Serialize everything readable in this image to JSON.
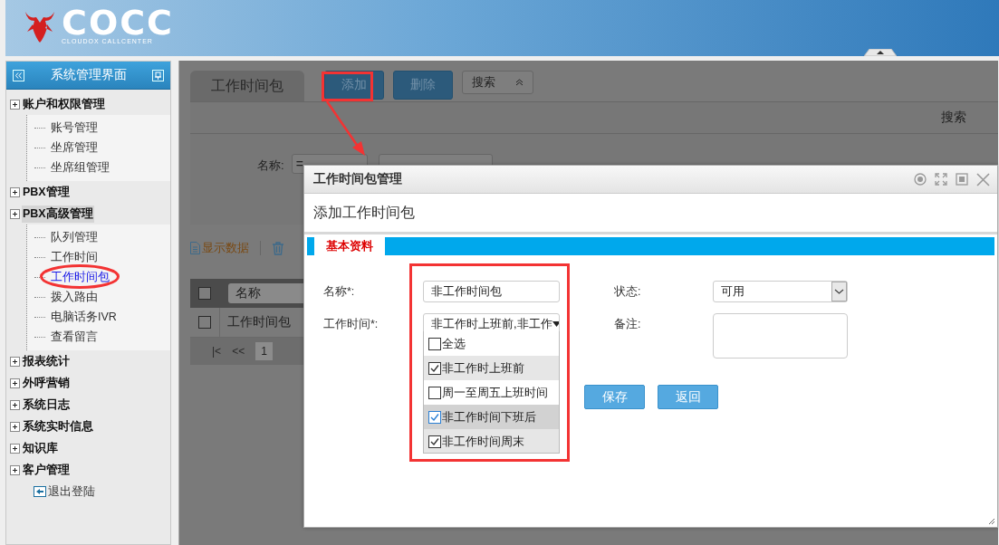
{
  "header": {
    "logo_text": "COCC",
    "logo_subtitle": "CLOUDOX CALLCENTER"
  },
  "sidebar": {
    "title": "系统管理界面",
    "items": [
      {
        "label": "账户和权限管理",
        "expanded": true,
        "highlighted": false,
        "children": [
          {
            "label": "账号管理",
            "selected": false
          },
          {
            "label": "坐席管理",
            "selected": false
          },
          {
            "label": "坐席组管理",
            "selected": false
          }
        ]
      },
      {
        "label": "PBX管理",
        "highlighted": false
      },
      {
        "label": "PBX高级管理",
        "expanded": true,
        "highlighted": true,
        "children": [
          {
            "label": "队列管理",
            "selected": false
          },
          {
            "label": "工作时间",
            "selected": false
          },
          {
            "label": "工作时间包",
            "selected": true
          },
          {
            "label": "拨入路由",
            "selected": false
          },
          {
            "label": "电脑话务IVR",
            "selected": false
          },
          {
            "label": "查看留言",
            "selected": false
          }
        ]
      },
      {
        "label": "报表统计",
        "highlighted": false
      },
      {
        "label": "外呼营销",
        "highlighted": false
      },
      {
        "label": "系统日志",
        "highlighted": false
      },
      {
        "label": "系统实时信息",
        "highlighted": false
      },
      {
        "label": "知识库",
        "highlighted": false
      },
      {
        "label": "客户管理",
        "highlighted": false
      }
    ],
    "logout": "退出登陆"
  },
  "main": {
    "tab": "工作时间包",
    "buttons": [
      "添加",
      "删除"
    ],
    "search_toggle": "搜索",
    "search_panel": {
      "title": "搜索",
      "name_label": "名称:",
      "operator": "="
    },
    "toolbar": [
      "显示数据"
    ],
    "table": {
      "all_checked": false,
      "columns": [
        "名称"
      ],
      "rows": [
        {
          "cells": [
            "工作时间包"
          ],
          "checked": false
        }
      ]
    },
    "pager": {
      "buttons": [
        "|<",
        "<<"
      ],
      "current_page": "1"
    }
  },
  "dialog": {
    "title": "工作时间包管理",
    "subtitle": "添加工作时间包",
    "tabs": [
      {
        "label": "基本资料",
        "selected": true
      }
    ],
    "name_label": "名称*:",
    "name_value": "非工作时间包",
    "worktime_label": "工作时间*:",
    "worktime_value": "非工作时上班前,非工作",
    "options": [
      {
        "label": "全选",
        "checked": false,
        "hovered": false
      },
      {
        "label": "非工作时上班前",
        "checked": true,
        "hovered": false
      },
      {
        "label": "周一至周五上班时间",
        "checked": false,
        "hovered": false
      },
      {
        "label": "非工作时间下班后",
        "checked": true,
        "hovered": true
      },
      {
        "label": "非工作时间周末",
        "checked": true,
        "hovered": false
      }
    ],
    "status_label": "状态:",
    "status_value": "可用",
    "remark_label": "备注:",
    "buttons": [
      "保存",
      "返回"
    ]
  }
}
